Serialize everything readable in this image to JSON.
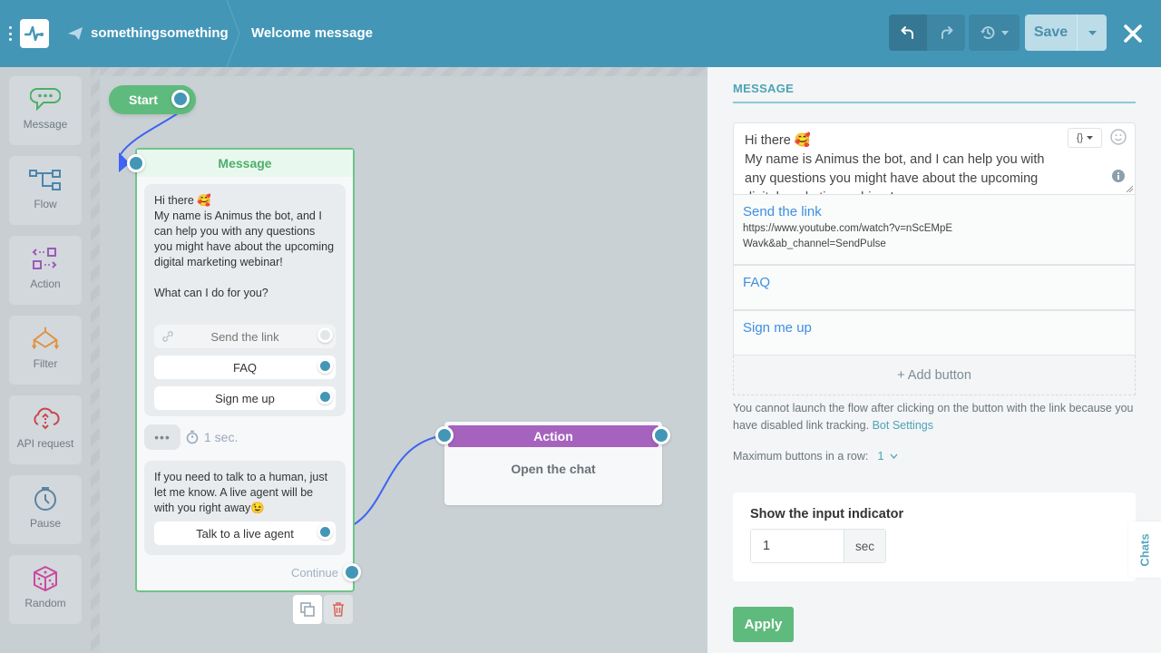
{
  "header": {
    "bot_name": "somethingsomething",
    "flow_name": "Welcome message",
    "save_label": "Save"
  },
  "toolbox": [
    {
      "label": "Message",
      "icon": "chat-bubble-icon",
      "color": "#4caf6a"
    },
    {
      "label": "Flow",
      "icon": "flow-icon",
      "color": "#4a86b0"
    },
    {
      "label": "Action",
      "icon": "action-icon",
      "color": "#9a5ab8"
    },
    {
      "label": "Filter",
      "icon": "filter-icon",
      "color": "#e0913f"
    },
    {
      "label": "API request",
      "icon": "cloud-icon",
      "color": "#c9474f"
    },
    {
      "label": "Pause",
      "icon": "stopwatch-icon",
      "color": "#5a84a3"
    },
    {
      "label": "Random",
      "icon": "dice-icon",
      "color": "#c94a9e"
    }
  ],
  "canvas": {
    "start_label": "Start",
    "message_node": {
      "title": "Message",
      "bubble1_lines": [
        "Hi there 🥰",
        "My name is Animus the bot, and I can help you with any questions you might have about the upcoming digital marketing webinar!",
        "",
        "What can I do for you?"
      ],
      "bubble1_text": "Hi there 🥰\nMy name is Animus the bot, and I can help you with any questions you might have about the upcoming digital marketing webinar!\n\nWhat can I do for you?",
      "buttons": [
        "Send the link",
        "FAQ",
        "Sign me up"
      ],
      "typing_delay": "1 sec.",
      "typing_dots": "•••",
      "bubble2_text": "If you need to talk to a human, just let me know. A live agent will be with you right away😉",
      "bubble2_button": "Talk to a live agent",
      "continue_label": "Continue"
    },
    "action_node": {
      "title": "Action",
      "body": "Open the chat"
    }
  },
  "panel": {
    "section_title": "MESSAGE",
    "editor_text": "Hi there 🥰\nMy name is Animus the bot, and I can help you with any questions you might have about the upcoming digital marketing webinar!",
    "var_button": "{}",
    "buttons": [
      {
        "label": "Send the link",
        "url": "https://www.youtube.com/watch?v=nScEMpEWavk&ab_channel=SendPulse"
      },
      {
        "label": "FAQ",
        "url": ""
      },
      {
        "label": "Sign me up",
        "url": ""
      }
    ],
    "add_button": "+ Add button",
    "note": "You cannot launch the flow after clicking on the button with the link because you have disabled link tracking.",
    "note_link": "Bot Settings",
    "max_buttons_label": "Maximum buttons in a row:",
    "max_buttons_value": "1",
    "indicator_title": "Show the input indicator",
    "indicator_value": "1",
    "indicator_suffix": "sec",
    "apply_label": "Apply",
    "chats_tab": "Chats"
  },
  "colors": {
    "header_bg": "#4496b7",
    "accent_green": "#5fba7d",
    "action_purple": "#a563be",
    "link_blue": "#3d8fe0",
    "port_blue": "#4496b7",
    "edge_blue": "#3f63f2"
  }
}
